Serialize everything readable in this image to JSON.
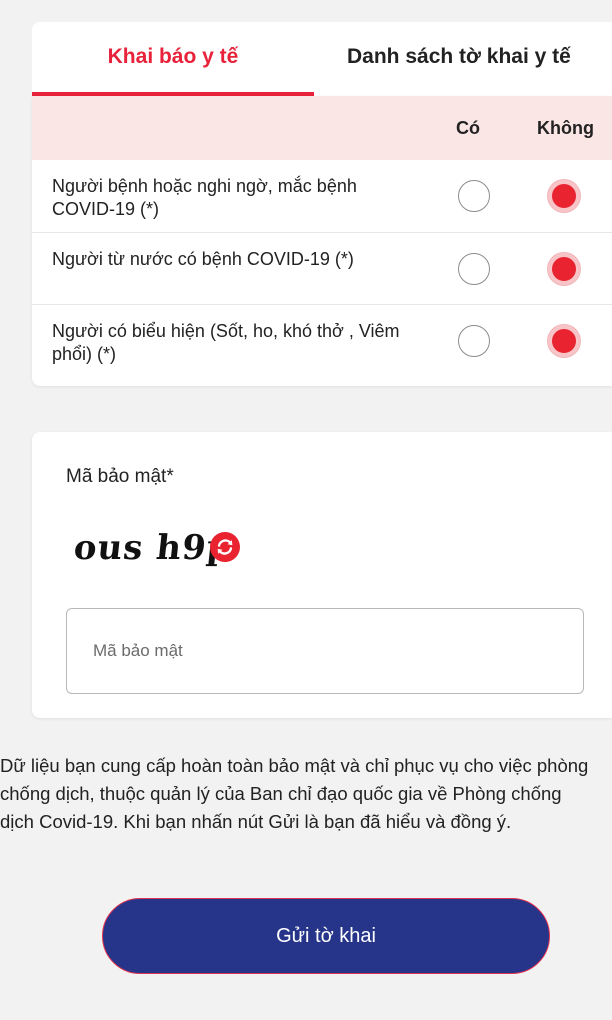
{
  "tabs": [
    {
      "label": "Khai báo y tế",
      "active": true
    },
    {
      "label": "Danh sách tờ khai y tế",
      "active": false
    }
  ],
  "questions": {
    "header_yes": "Có",
    "header_no": "Không",
    "rows": [
      {
        "text": "Người bệnh hoặc nghi ngờ, mắc bệnh COVID-19 (*)",
        "answer": "Không"
      },
      {
        "text": "Người từ nước có bệnh COVID-19 (*)",
        "answer": "Không"
      },
      {
        "text": "Người có biểu hiện (Sốt, ho, khó thở , Viêm phổi) (*)",
        "answer": "Không"
      }
    ]
  },
  "security": {
    "label": "Mã bảo mật*",
    "captcha_text": "ous h9p",
    "input_placeholder": "Mã bảo mật",
    "input_value": ""
  },
  "notice": "Dữ liệu bạn cung cấp hoàn toàn bảo mật và chỉ phục vụ cho việc phòng chống dịch, thuộc quản lý của Ban chỉ đạo quốc gia về Phòng chống dịch Covid-19. Khi bạn nhấn nút Gửi là bạn đã hiểu và đồng ý.",
  "submit_label": "Gửi tờ khai",
  "colors": {
    "accent": "#e8223a",
    "button": "#263589",
    "header_bg": "#fbe6e6"
  },
  "icons": {
    "refresh": "refresh-icon"
  }
}
